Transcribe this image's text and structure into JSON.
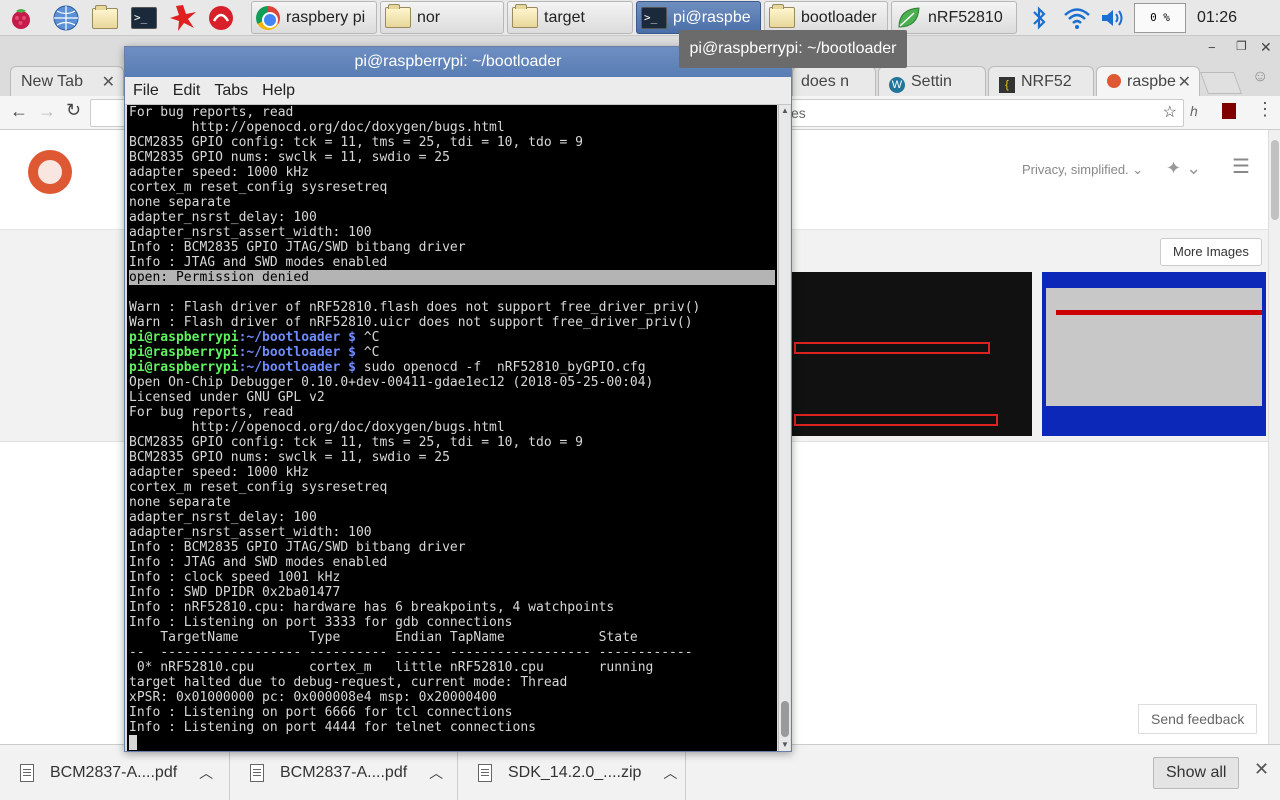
{
  "taskbar": {
    "tasks": [
      {
        "label": "raspbery pi",
        "icon": "chrome-icon"
      },
      {
        "label": "nor",
        "icon": "folder-icon"
      },
      {
        "label": "target",
        "icon": "folder-icon"
      },
      {
        "label": "pi@raspbe",
        "icon": "terminal-icon"
      },
      {
        "label": "bootloader",
        "icon": "folder-icon"
      },
      {
        "label": "nRF52810",
        "icon": "leaf-icon"
      }
    ],
    "cpu": "0 %",
    "clock": "01:26"
  },
  "tooltip": "pi@raspberrypi: ~/bootloader",
  "chrome": {
    "window_title": "",
    "tabs": [
      {
        "label": "New Tab"
      },
      {
        "label": "does n"
      },
      {
        "label": "Settin"
      },
      {
        "label": "NRF52"
      },
      {
        "label": "raspbe"
      }
    ],
    "omnibox_text": "es",
    "privacy_text": "Privacy, simplified.",
    "more_images": "More Images",
    "send_feedback": "Send feedback"
  },
  "downloads": {
    "items": [
      {
        "name": "BCM2837-A....pdf"
      },
      {
        "name": "BCM2837-A....pdf"
      },
      {
        "name": "SDK_14.2.0_....zip"
      }
    ],
    "show_all": "Show all"
  },
  "terminal": {
    "title": "pi@raspberrypi: ~/bootloader",
    "menu": [
      "File",
      "Edit",
      "Tabs",
      "Help"
    ],
    "prompt_user": "pi@raspberrypi",
    "prompt_path": ":~/bootloader $",
    "lines": [
      {
        "t": "For bug reports, read"
      },
      {
        "t": "        http://openocd.org/doc/doxygen/bugs.html"
      },
      {
        "t": "BCM2835 GPIO config: tck = 11, tms = 25, tdi = 10, tdo = 9"
      },
      {
        "t": "BCM2835 GPIO nums: swclk = 11, swdio = 25"
      },
      {
        "t": "adapter speed: 1000 kHz"
      },
      {
        "t": "cortex_m reset_config sysresetreq"
      },
      {
        "t": "none separate"
      },
      {
        "t": "adapter_nsrst_delay: 100"
      },
      {
        "t": "adapter_nsrst_assert_width: 100"
      },
      {
        "t": "Info : BCM2835 GPIO JTAG/SWD bitbang driver"
      },
      {
        "t": "Info : JTAG and SWD modes enabled"
      },
      {
        "t": "open: Permission denied",
        "sel": true
      },
      {
        "t": ""
      },
      {
        "t": "Warn : Flash driver of nRF52810.flash does not support free_driver_priv()"
      },
      {
        "t": "Warn : Flash driver of nRF52810.uicr does not support free_driver_priv()"
      },
      {
        "prompt": true,
        "cmd": " ^C"
      },
      {
        "prompt": true,
        "cmd": " ^C"
      },
      {
        "prompt": true,
        "cmd": " sudo openocd -f  nRF52810_byGPIO.cfg"
      },
      {
        "t": "Open On-Chip Debugger 0.10.0+dev-00411-gdae1ec12 (2018-05-25-00:04)"
      },
      {
        "t": "Licensed under GNU GPL v2"
      },
      {
        "t": "For bug reports, read"
      },
      {
        "t": "        http://openocd.org/doc/doxygen/bugs.html"
      },
      {
        "t": "BCM2835 GPIO config: tck = 11, tms = 25, tdi = 10, tdo = 9"
      },
      {
        "t": "BCM2835 GPIO nums: swclk = 11, swdio = 25"
      },
      {
        "t": "adapter speed: 1000 kHz"
      },
      {
        "t": "cortex_m reset_config sysresetreq"
      },
      {
        "t": "none separate"
      },
      {
        "t": "adapter_nsrst_delay: 100"
      },
      {
        "t": "adapter_nsrst_assert_width: 100"
      },
      {
        "t": "Info : BCM2835 GPIO JTAG/SWD bitbang driver"
      },
      {
        "t": "Info : JTAG and SWD modes enabled"
      },
      {
        "t": "Info : clock speed 1001 kHz"
      },
      {
        "t": "Info : SWD DPIDR 0x2ba01477"
      },
      {
        "t": "Info : nRF52810.cpu: hardware has 6 breakpoints, 4 watchpoints"
      },
      {
        "t": "Info : Listening on port 3333 for gdb connections"
      },
      {
        "t": "    TargetName         Type       Endian TapName            State"
      },
      {
        "t": "--  ------------------ ---------- ------ ------------------ ------------"
      },
      {
        "t": " 0* nRF52810.cpu       cortex_m   little nRF52810.cpu       running"
      },
      {
        "t": "target halted due to debug-request, current mode: Thread"
      },
      {
        "t": "xPSR: 0x01000000 pc: 0x000008e4 msp: 0x20000400"
      },
      {
        "t": "Info : Listening on port 6666 for tcl connections"
      },
      {
        "t": "Info : Listening on port 4444 for telnet connections"
      }
    ]
  }
}
